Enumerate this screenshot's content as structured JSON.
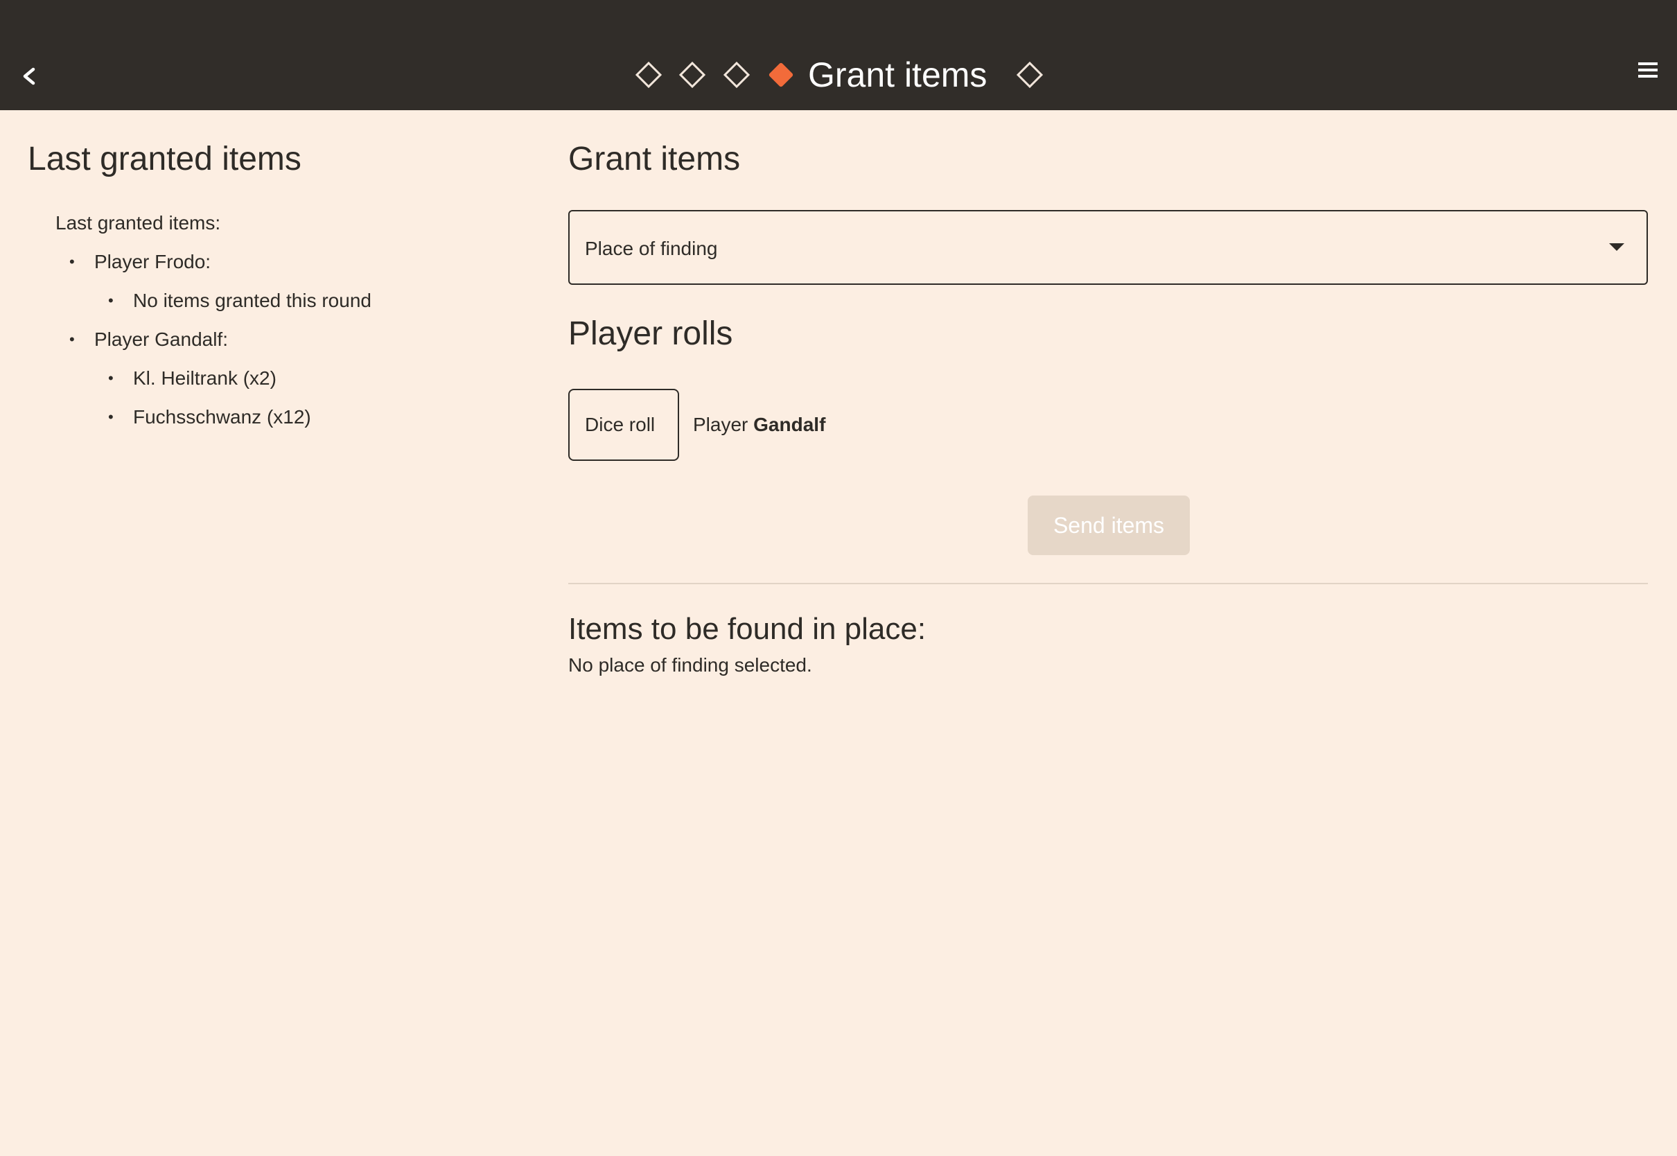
{
  "topbar": {
    "title": "Grant items",
    "back_icon": "chevron-left-icon",
    "menu_icon": "hamburger-menu-icon",
    "steps": [
      {
        "state": "inactive"
      },
      {
        "state": "inactive"
      },
      {
        "state": "inactive"
      },
      {
        "state": "active"
      },
      {
        "state": "inactive"
      }
    ],
    "active_color": "#F26B3A",
    "inactive_color": "#F2E6DB"
  },
  "left": {
    "title": "Last granted items",
    "intro": "Last granted items:",
    "players": [
      {
        "label": "Player Frodo:",
        "items": [
          "No items granted this round"
        ]
      },
      {
        "label": "Player Gandalf:",
        "items": [
          "Kl. Heiltrank (x2)",
          "Fuchsschwanz (x12)"
        ]
      }
    ]
  },
  "right": {
    "title": "Grant items",
    "select_placeholder": "Place of finding",
    "rolls_title": "Player rolls",
    "dice_button": "Dice roll",
    "player_prefix": "Player",
    "player_name": "Gandalf",
    "send_button": "Send items",
    "items_title": "Items to be found in place:",
    "items_desc": "No place of finding selected."
  }
}
